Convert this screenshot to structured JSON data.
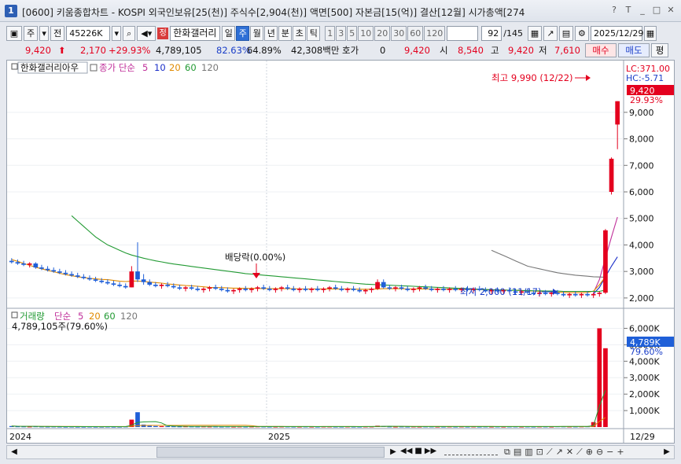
{
  "window": {
    "number": "1",
    "title": "[0600] 키움종합차트 - KOSPI 외국인보유[25(천)] 주식수[2,904(천)] 액면[500] 자본금[15(억)] 결산[12월] 시가총액[274"
  },
  "toolbar": {
    "market": "주",
    "all": "전",
    "code": "45226K",
    "code_badge": "정",
    "stock_name": "한화갤러리",
    "periods": [
      "일",
      "주",
      "월",
      "년",
      "분",
      "초",
      "틱"
    ],
    "selected_period": "주",
    "intervals": [
      "1",
      "3",
      "5",
      "10",
      "20",
      "30",
      "60",
      "120"
    ],
    "page_count": "92",
    "page_total": "/145",
    "date": "2025/12/29"
  },
  "quote": {
    "price": "9,420",
    "change": "2,170",
    "change_pct": "+29.93%",
    "volume": "4,789,105",
    "vol_ratio1": "82.63%",
    "vol_ratio2": "64.89%",
    "amount": "42,308백만",
    "hoga_label": "호가",
    "hoga_value": "0",
    "hoga_price": "9,420",
    "open_label": "시",
    "open": "8,540",
    "high_label": "고",
    "high": "9,420",
    "low_label": "저",
    "low": "7,610",
    "buy_label": "매수",
    "sell_label": "매도",
    "flat_label": "평"
  },
  "price_panel": {
    "legend_name": "한화갤러리아우",
    "legend_ma": "종가 단순",
    "ma_periods": [
      "5",
      "10",
      "20",
      "60",
      "120"
    ],
    "lc_label": "LC:371.00",
    "hc_label": "HC:-5.71",
    "current_price": "9,420",
    "current_pct": "29.93%",
    "high_annotation": "최고 9,990 (12/22)",
    "low_annotation": "최저 2,000 (11/17)",
    "dividend_annotation": "배당락(0.00%)",
    "y_ticks": [
      "9,000",
      "8,000",
      "7,000",
      "6,000",
      "5,000",
      "4,000",
      "3,000",
      "2,000"
    ]
  },
  "volume_panel": {
    "legend_name": "거래량",
    "legend_ma": "단순",
    "ma_periods": [
      "5",
      "20",
      "60",
      "120"
    ],
    "volume_text": "4,789,105주(79.60%)",
    "current_volume": "4,789K",
    "current_pct": "79.60%",
    "y_ticks": [
      "6,000K",
      "5,000K",
      "4,000K",
      "3,000K",
      "2,000K",
      "1,000K"
    ]
  },
  "x_axis": {
    "labels": [
      "2024",
      "2025"
    ],
    "last_date": "12/29"
  },
  "colors": {
    "up": "#e4001e",
    "down": "#1f5fd8",
    "ma5": "#c0309a",
    "ma10": "#1a2ec8",
    "ma20": "#e08a00",
    "ma60": "#229a33",
    "ma120": "#777777"
  },
  "chart_data": {
    "type": "candlestick",
    "period": "weekly",
    "high_point": {
      "date": "12/22",
      "value": 9990
    },
    "low_point": {
      "date": "11/17",
      "value": 2000
    },
    "last": {
      "open": 8540,
      "high": 9420,
      "low": 7610,
      "close": 9420,
      "volume": 4789105
    },
    "y_range": [
      1700,
      10300
    ],
    "candles": [
      [
        3400,
        3500,
        3300,
        3350
      ],
      [
        3350,
        3450,
        3250,
        3300
      ],
      [
        3300,
        3400,
        3200,
        3250
      ],
      [
        3250,
        3350,
        3150,
        3300
      ],
      [
        3300,
        3350,
        3100,
        3150
      ],
      [
        3150,
        3250,
        3050,
        3100
      ],
      [
        3100,
        3200,
        3000,
        3050
      ],
      [
        3050,
        3150,
        2950,
        3000
      ],
      [
        3000,
        3100,
        2900,
        2950
      ],
      [
        2950,
        3050,
        2850,
        2900
      ],
      [
        2900,
        3000,
        2800,
        2850
      ],
      [
        2850,
        2950,
        2750,
        2800
      ],
      [
        2800,
        2900,
        2700,
        2750
      ],
      [
        2750,
        2850,
        2650,
        2700
      ],
      [
        2700,
        2800,
        2600,
        2650
      ],
      [
        2650,
        2750,
        2550,
        2600
      ],
      [
        2600,
        2700,
        2500,
        2550
      ],
      [
        2550,
        2650,
        2450,
        2500
      ],
      [
        2500,
        2600,
        2400,
        2450
      ],
      [
        2450,
        2550,
        2350,
        2400
      ],
      [
        2400,
        3200,
        2400,
        3000
      ],
      [
        3000,
        4100,
        2600,
        2700
      ],
      [
        2700,
        2900,
        2500,
        2600
      ],
      [
        2600,
        2700,
        2450,
        2500
      ],
      [
        2500,
        2600,
        2400,
        2450
      ],
      [
        2450,
        2550,
        2350,
        2500
      ],
      [
        2500,
        2600,
        2400,
        2450
      ],
      [
        2450,
        2550,
        2350,
        2400
      ],
      [
        2400,
        2500,
        2300,
        2350
      ],
      [
        2350,
        2450,
        2250,
        2400
      ],
      [
        2400,
        2500,
        2300,
        2350
      ],
      [
        2350,
        2450,
        2250,
        2300
      ],
      [
        2300,
        2400,
        2200,
        2350
      ],
      [
        2350,
        2450,
        2250,
        2400
      ],
      [
        2400,
        2500,
        2300,
        2350
      ],
      [
        2350,
        2450,
        2250,
        2300
      ],
      [
        2300,
        2400,
        2200,
        2250
      ],
      [
        2250,
        2350,
        2150,
        2300
      ],
      [
        2300,
        2400,
        2200,
        2350
      ],
      [
        2350,
        2450,
        2250,
        2300
      ],
      [
        2300,
        2400,
        2200,
        2350
      ],
      [
        2350,
        2450,
        2250,
        2400
      ],
      [
        2400,
        2500,
        2300,
        2350
      ],
      [
        2350,
        2450,
        2250,
        2300
      ],
      [
        2300,
        2400,
        2200,
        2350
      ],
      [
        2350,
        2450,
        2250,
        2400
      ],
      [
        2400,
        2500,
        2300,
        2350
      ],
      [
        2350,
        2450,
        2250,
        2300
      ],
      [
        2300,
        2400,
        2200,
        2350
      ],
      [
        2350,
        2450,
        2250,
        2300
      ],
      [
        2300,
        2400,
        2200,
        2350
      ],
      [
        2350,
        2450,
        2250,
        2300
      ],
      [
        2300,
        2400,
        2200,
        2350
      ],
      [
        2350,
        2450,
        2250,
        2400
      ],
      [
        2400,
        2500,
        2300,
        2350
      ],
      [
        2350,
        2450,
        2250,
        2300
      ],
      [
        2300,
        2400,
        2200,
        2350
      ],
      [
        2350,
        2450,
        2250,
        2300
      ],
      [
        2300,
        2400,
        2200,
        2250
      ],
      [
        2250,
        2350,
        2150,
        2300
      ],
      [
        2300,
        2400,
        2200,
        2350
      ],
      [
        2350,
        2700,
        2300,
        2600
      ],
      [
        2600,
        2700,
        2350,
        2400
      ],
      [
        2400,
        2500,
        2300,
        2350
      ],
      [
        2350,
        2450,
        2250,
        2400
      ],
      [
        2400,
        2500,
        2300,
        2350
      ],
      [
        2350,
        2450,
        2250,
        2300
      ],
      [
        2300,
        2400,
        2200,
        2350
      ],
      [
        2350,
        2450,
        2250,
        2400
      ],
      [
        2400,
        2500,
        2300,
        2350
      ],
      [
        2350,
        2450,
        2250,
        2300
      ],
      [
        2300,
        2400,
        2200,
        2350
      ],
      [
        2350,
        2450,
        2250,
        2300
      ],
      [
        2300,
        2400,
        2200,
        2350
      ],
      [
        2350,
        2450,
        2250,
        2300
      ],
      [
        2300,
        2400,
        2200,
        2350
      ],
      [
        2350,
        2450,
        2250,
        2300
      ],
      [
        2300,
        2400,
        2200,
        2350
      ],
      [
        2350,
        2450,
        2250,
        2300
      ],
      [
        2300,
        2400,
        2200,
        2250
      ],
      [
        2250,
        2350,
        2150,
        2300
      ],
      [
        2300,
        2400,
        2200,
        2250
      ],
      [
        2250,
        2350,
        2150,
        2300
      ],
      [
        2300,
        2400,
        2200,
        2250
      ],
      [
        2250,
        2350,
        2150,
        2200
      ],
      [
        2200,
        2300,
        2100,
        2250
      ],
      [
        2250,
        2350,
        2150,
        2200
      ],
      [
        2200,
        2300,
        2100,
        2150
      ],
      [
        2150,
        2250,
        2050,
        2200
      ],
      [
        2200,
        2300,
        2100,
        2150
      ],
      [
        2150,
        2250,
        2050,
        2200
      ],
      [
        2200,
        2300,
        2100,
        2150
      ],
      [
        2150,
        2250,
        2050,
        2100
      ],
      [
        2100,
        2200,
        2000,
        2150
      ],
      [
        2150,
        2250,
        2050,
        2100
      ],
      [
        2100,
        2200,
        2000,
        2150
      ],
      [
        2150,
        2250,
        2050,
        2100
      ],
      [
        2100,
        2200,
        2000,
        2150
      ],
      [
        2150,
        2250,
        2050,
        2200
      ],
      [
        2200,
        4600,
        2150,
        4550
      ],
      [
        6000,
        7300,
        5900,
        7250
      ],
      [
        8540,
        9420,
        7610,
        9420
      ]
    ],
    "volumes": [
      60,
      40,
      35,
      30,
      40,
      30,
      25,
      30,
      25,
      20,
      25,
      20,
      20,
      25,
      20,
      20,
      25,
      20,
      20,
      30,
      450,
      900,
      150,
      80,
      60,
      50,
      45,
      40,
      35,
      40,
      35,
      30,
      35,
      30,
      30,
      25,
      30,
      25,
      30,
      25,
      30,
      35,
      30,
      25,
      25,
      30,
      30,
      25,
      25,
      30,
      25,
      25,
      30,
      30,
      25,
      25,
      30,
      25,
      25,
      30,
      30,
      80,
      60,
      30,
      25,
      30,
      25,
      30,
      25,
      30,
      30,
      25,
      25,
      30,
      25,
      30,
      25,
      30,
      25,
      30,
      25,
      30,
      25,
      30,
      30,
      25,
      30,
      25,
      30,
      30,
      25,
      40,
      35,
      30,
      30,
      35,
      40,
      300,
      6000,
      4789
    ],
    "ma_series": {
      "ma5": {
        "start": 97,
        "values": [
          2200,
          2700,
          3500,
          4300,
          5050
        ]
      },
      "ma10": {
        "start": 97,
        "values": [
          2150,
          2400,
          2800,
          3200,
          3550
        ]
      },
      "ma20": {
        "start": 0,
        "values": [
          3450,
          3380,
          3300,
          3230,
          3160,
          3100,
          3040,
          2990,
          2930,
          2880,
          2840,
          2800,
          2770,
          2740,
          2720,
          2700,
          2690,
          2660,
          2630,
          2620,
          2630,
          2640,
          2620,
          2600,
          2580,
          2560,
          2530,
          2510,
          2490,
          2470,
          2460,
          2440,
          2420,
          2400,
          2390,
          2390,
          2380,
          2370,
          2370,
          2360,
          2360,
          2360,
          2350,
          2350,
          2350,
          2350,
          2350,
          2350,
          2340,
          2340,
          2340,
          2340,
          2340,
          2340,
          2340,
          2340,
          2340,
          2340,
          2330,
          2330,
          2330,
          2340,
          2350,
          2350,
          2350,
          2350,
          2340,
          2340,
          2340,
          2340,
          2340,
          2330,
          2330,
          2330,
          2330,
          2320,
          2320,
          2320,
          2320,
          2310,
          2310,
          2300,
          2300,
          2290,
          2290,
          2280,
          2270,
          2260,
          2250,
          2240,
          2230,
          2220,
          2210,
          2200,
          2200,
          2200,
          2210,
          2260,
          2500,
          2800
        ]
      },
      "ma60": {
        "start": 10,
        "values": [
          5100,
          4900,
          4700,
          4500,
          4300,
          4150,
          4000,
          3900,
          3800,
          3700,
          3620,
          3560,
          3500,
          3450,
          3400,
          3360,
          3320,
          3280,
          3250,
          3220,
          3190,
          3160,
          3130,
          3100,
          3070,
          3040,
          3010,
          2980,
          2950,
          2920,
          2900,
          2880,
          2860,
          2840,
          2820,
          2800,
          2780,
          2760,
          2740,
          2720,
          2700,
          2680,
          2660,
          2640,
          2620,
          2600,
          2580,
          2560,
          2540,
          2520,
          2510,
          2500,
          2490,
          2480,
          2470,
          2460,
          2450,
          2440,
          2430,
          2420,
          2410,
          2400,
          2390,
          2380,
          2370,
          2360,
          2350,
          2340,
          2330,
          2320,
          2310,
          2300,
          2300,
          2290,
          2290,
          2280,
          2280,
          2270,
          2270,
          2260,
          2260,
          2260,
          2250,
          2250,
          2250,
          2250,
          2250,
          2250,
          2250,
          2300
        ]
      },
      "ma120": {
        "start": 80,
        "values": [
          3800,
          3700,
          3600,
          3500,
          3400,
          3300,
          3200,
          3150,
          3100,
          3050,
          3000,
          2950,
          2920,
          2890,
          2860,
          2840,
          2820,
          2800,
          2790,
          2780
        ]
      }
    }
  }
}
